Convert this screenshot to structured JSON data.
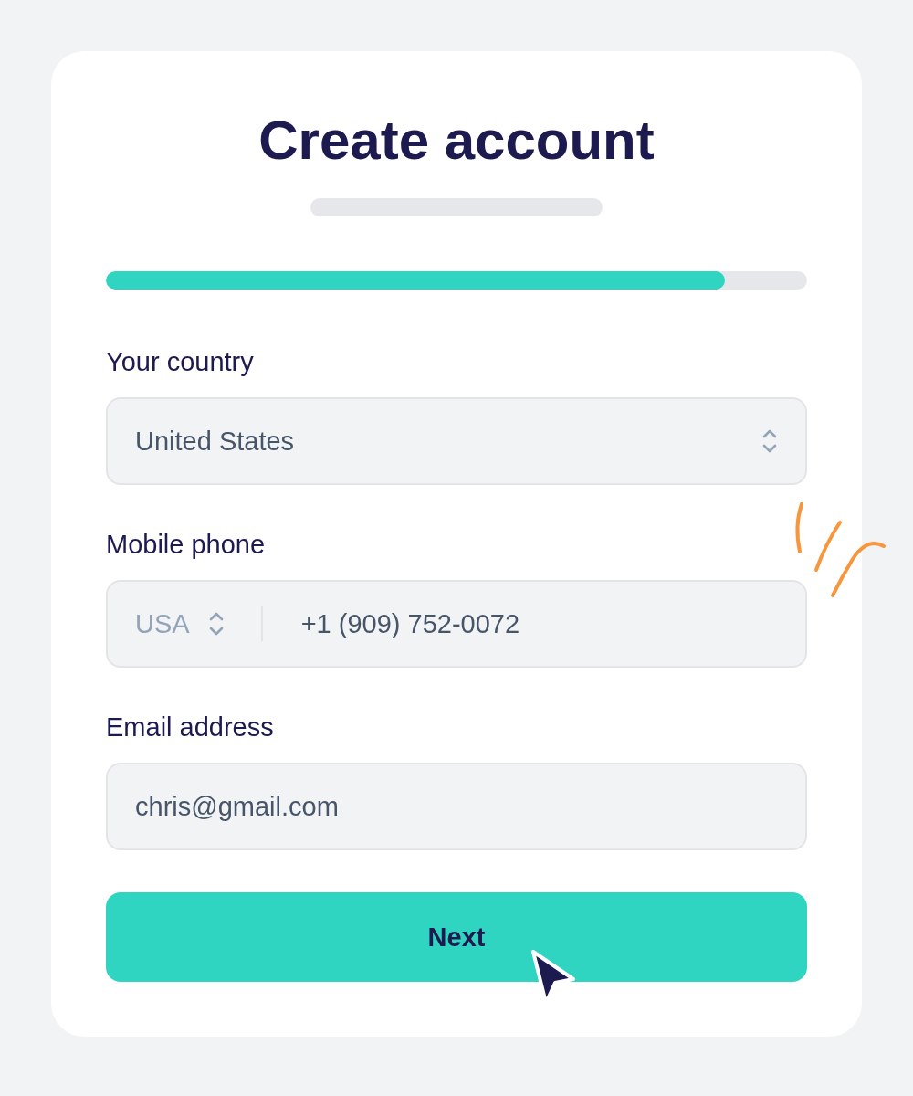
{
  "title": "Create account",
  "progress": {
    "level": 0.883
  },
  "fields": [
    {
      "kind": "select",
      "label": "Your country",
      "value": "United States"
    },
    {
      "kind": "phone",
      "label": "Mobile phone",
      "code": "USA",
      "value": "+1 (909) 752-0072"
    },
    {
      "kind": "text",
      "label": "Email address",
      "value": "chris@gmail.com"
    }
  ],
  "button": {
    "label": "Next"
  }
}
